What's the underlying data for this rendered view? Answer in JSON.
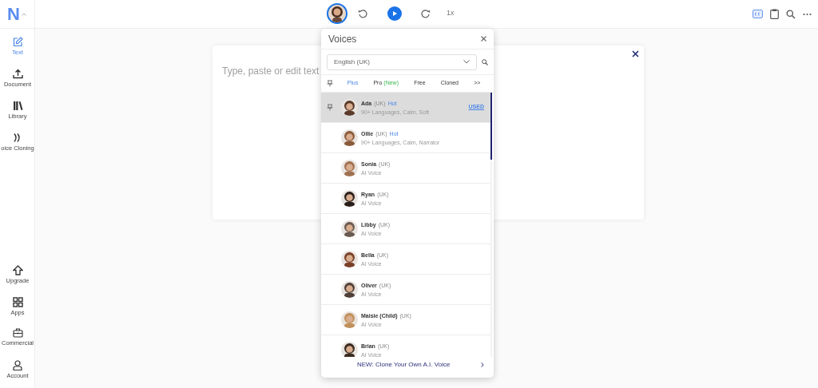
{
  "logo": {
    "text": "N"
  },
  "sidebar": {
    "top_items": [
      {
        "label": "Text",
        "selected": true
      },
      {
        "label": "Document",
        "selected": false
      },
      {
        "label": "Library",
        "selected": false
      },
      {
        "label": "oice Cloning",
        "selected": false
      }
    ],
    "bottom_items": [
      {
        "label": "Upgrade",
        "selected": false
      },
      {
        "label": "Apps",
        "selected": false
      },
      {
        "label": "Commercial",
        "selected": false
      },
      {
        "label": "Account",
        "selected": false
      }
    ]
  },
  "player": {
    "speed": "1x"
  },
  "editor": {
    "placeholder": "Type, paste or edit text"
  },
  "voices_panel": {
    "title": "Voices",
    "language": "English (UK)",
    "tabs": [
      {
        "label": "Plus",
        "selected": true
      },
      {
        "label": "Pro",
        "badge": "(New)",
        "selected": false
      },
      {
        "label": "Free",
        "selected": false
      },
      {
        "label": "Cloned",
        "selected": false
      },
      {
        "label": ">>",
        "selected": false
      }
    ],
    "voices": [
      {
        "name": "Ada",
        "accent": "(UK)",
        "tag": "Hot",
        "description": "90+ Languages, Calm, Soft",
        "status": "USED",
        "pinned": true,
        "selected": true,
        "color": "#5a3a2a"
      },
      {
        "name": "Ollie",
        "accent": "(UK)",
        "tag": "Hot",
        "description": "90+ Languages, Calm, Narrator",
        "pinned": false,
        "selected": false,
        "color": "#8a5a3a"
      },
      {
        "name": "Sonia",
        "accent": "(UK)",
        "description": "AI Voice",
        "pinned": false,
        "selected": false,
        "color": "#a07050"
      },
      {
        "name": "Ryan",
        "accent": "(UK)",
        "description": "AI Voice",
        "pinned": false,
        "selected": false,
        "color": "#2a1e18"
      },
      {
        "name": "Libby",
        "accent": "(UK)",
        "description": "AI Voice",
        "pinned": false,
        "selected": false,
        "color": "#6a5a50"
      },
      {
        "name": "Bella",
        "accent": "(UK)",
        "description": "AI Voice",
        "pinned": false,
        "selected": false,
        "color": "#7a4028"
      },
      {
        "name": "Oliver",
        "accent": "(UK)",
        "description": "AI Voice",
        "pinned": false,
        "selected": false,
        "color": "#504038"
      },
      {
        "name": "Maisie (Child)",
        "accent": "(UK)",
        "description": "AI Voice",
        "pinned": false,
        "selected": false,
        "color": "#c0905a"
      },
      {
        "name": "Brian",
        "accent": "(UK)",
        "description": "AI Voice",
        "pinned": false,
        "selected": false,
        "color": "#3a2a20"
      }
    ],
    "footer_link": "NEW: Clone Your Own A.I. Voice"
  }
}
